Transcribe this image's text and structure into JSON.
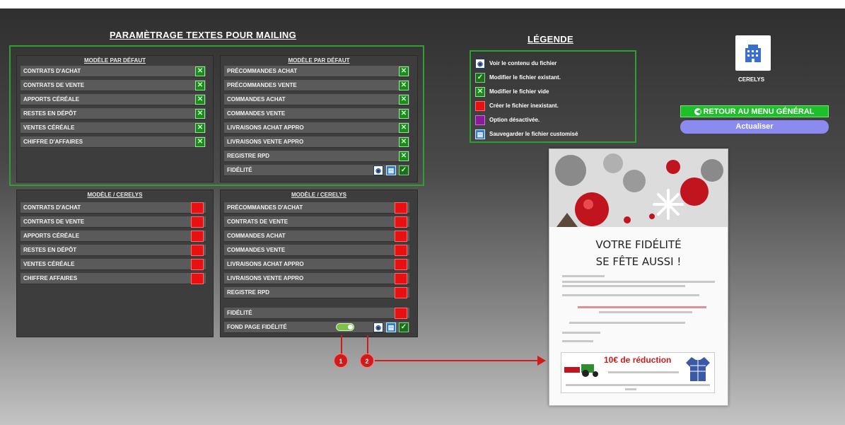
{
  "header": {
    "main_title": "PARAMÈTRAGE TEXTES POUR MAILING",
    "legend_title": "LÉGENDE"
  },
  "default_left": {
    "heading": "MODÈLE PAR DÉFAUT",
    "rows": [
      {
        "label": "CONTRATS D'ACHAT",
        "icon": "x-icon"
      },
      {
        "label": "CONTRATS DE VENTE",
        "icon": "x-icon"
      },
      {
        "label": "APPORTS CÉRÉALE",
        "icon": "x-icon"
      },
      {
        "label": "RESTES EN DÉPÔT",
        "icon": "x-icon"
      },
      {
        "label": "VENTES CÉRÉALE",
        "icon": "x-icon"
      },
      {
        "label": "CHIFFRE D'AFFAIRES",
        "icon": "x-icon"
      }
    ]
  },
  "default_right": {
    "heading": "MODÈLE PAR DÉFAUT",
    "rows": [
      {
        "label": "PRÉCOMMANDES ACHAT",
        "icon": "x-icon"
      },
      {
        "label": "PRÉCOMMANDES VENTE",
        "icon": "x-icon"
      },
      {
        "label": "COMMANDES ACHAT",
        "icon": "x-icon"
      },
      {
        "label": "COMMANDES VENTE",
        "icon": "x-icon"
      },
      {
        "label": "LIVRAISONS ACHAT APPRO",
        "icon": "x-icon"
      },
      {
        "label": "LIVRAISONS VENTE APPRO",
        "icon": "x-icon"
      },
      {
        "label": "REGISTRE RPD",
        "icon": "x-icon"
      },
      {
        "label": "FIDÉLITÉ",
        "icon": "view-save-check"
      }
    ]
  },
  "cerelys_left": {
    "heading": "MODÈLE / CERELYS",
    "rows": [
      {
        "label": "CONTRATS D'ACHAT"
      },
      {
        "label": "CONTRATS DE VENTE"
      },
      {
        "label": "APPORTS CÉRÉALE"
      },
      {
        "label": "RESTES EN DÉPÔT"
      },
      {
        "label": "VENTES CÉRÉALE"
      },
      {
        "label": "CHIFFRE AFFAIRES"
      }
    ]
  },
  "cerelys_right": {
    "heading": "MODÈLE / CERELYS",
    "rows": [
      {
        "label": "PRÉCOMMANDES D'ACHAT"
      },
      {
        "label": "CONTRATS DE VENTE"
      },
      {
        "label": "COMMANDES ACHAT"
      },
      {
        "label": "COMMANDES VENTE"
      },
      {
        "label": "LIVRAISONS ACHAT APPRO"
      },
      {
        "label": "LIVRAISONS VENTE APPRO"
      },
      {
        "label": "REGISTRE RPD"
      },
      {
        "label": "FIDÉLITÉ"
      },
      {
        "label": "FOND PAGE FIDÉLITÉ"
      }
    ]
  },
  "legend": {
    "items": [
      {
        "icon": "view-icon",
        "text": "Voir le contenu du fichier"
      },
      {
        "icon": "check-icon",
        "text": "Modifier le fichier existant."
      },
      {
        "icon": "x-icon",
        "text": "Modifier le fichier vide"
      },
      {
        "icon": "red-square-icon",
        "text": "Créer le fichier inexistant."
      },
      {
        "icon": "purple-square-icon",
        "text": "Option désactivée."
      },
      {
        "icon": "save-icon",
        "text": "Sauvegarder le fichier customisé"
      }
    ]
  },
  "brand": {
    "caption": "CERELYS"
  },
  "buttons": {
    "back_label": "RETOUR AU MENU GÉNÉRAL",
    "refresh_label": "Actualiser"
  },
  "callouts": {
    "one": "1",
    "two": "2"
  },
  "poster": {
    "title_line1": "VOTRE FIDÉLITÉ",
    "title_line2": "SE FÊTE AUSSI !",
    "coupon_title": "10€ de réduction"
  },
  "colors": {
    "frame_green": "#2fa02f",
    "create_red": "#e81010",
    "disabled_purple": "#8a1a9a",
    "button_green": "#1fbf2a",
    "button_blue": "#8a8af0",
    "callout_red": "#d11a1a"
  }
}
